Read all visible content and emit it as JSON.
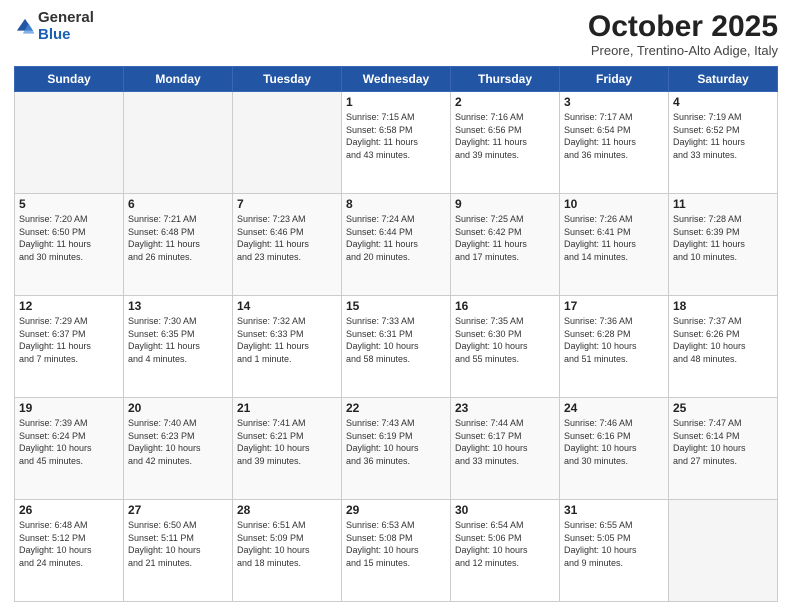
{
  "header": {
    "logo_general": "General",
    "logo_blue": "Blue",
    "month_title": "October 2025",
    "subtitle": "Preore, Trentino-Alto Adige, Italy"
  },
  "weekdays": [
    "Sunday",
    "Monday",
    "Tuesday",
    "Wednesday",
    "Thursday",
    "Friday",
    "Saturday"
  ],
  "weeks": [
    [
      {
        "day": "",
        "info": ""
      },
      {
        "day": "",
        "info": ""
      },
      {
        "day": "",
        "info": ""
      },
      {
        "day": "1",
        "info": "Sunrise: 7:15 AM\nSunset: 6:58 PM\nDaylight: 11 hours\nand 43 minutes."
      },
      {
        "day": "2",
        "info": "Sunrise: 7:16 AM\nSunset: 6:56 PM\nDaylight: 11 hours\nand 39 minutes."
      },
      {
        "day": "3",
        "info": "Sunrise: 7:17 AM\nSunset: 6:54 PM\nDaylight: 11 hours\nand 36 minutes."
      },
      {
        "day": "4",
        "info": "Sunrise: 7:19 AM\nSunset: 6:52 PM\nDaylight: 11 hours\nand 33 minutes."
      }
    ],
    [
      {
        "day": "5",
        "info": "Sunrise: 7:20 AM\nSunset: 6:50 PM\nDaylight: 11 hours\nand 30 minutes."
      },
      {
        "day": "6",
        "info": "Sunrise: 7:21 AM\nSunset: 6:48 PM\nDaylight: 11 hours\nand 26 minutes."
      },
      {
        "day": "7",
        "info": "Sunrise: 7:23 AM\nSunset: 6:46 PM\nDaylight: 11 hours\nand 23 minutes."
      },
      {
        "day": "8",
        "info": "Sunrise: 7:24 AM\nSunset: 6:44 PM\nDaylight: 11 hours\nand 20 minutes."
      },
      {
        "day": "9",
        "info": "Sunrise: 7:25 AM\nSunset: 6:42 PM\nDaylight: 11 hours\nand 17 minutes."
      },
      {
        "day": "10",
        "info": "Sunrise: 7:26 AM\nSunset: 6:41 PM\nDaylight: 11 hours\nand 14 minutes."
      },
      {
        "day": "11",
        "info": "Sunrise: 7:28 AM\nSunset: 6:39 PM\nDaylight: 11 hours\nand 10 minutes."
      }
    ],
    [
      {
        "day": "12",
        "info": "Sunrise: 7:29 AM\nSunset: 6:37 PM\nDaylight: 11 hours\nand 7 minutes."
      },
      {
        "day": "13",
        "info": "Sunrise: 7:30 AM\nSunset: 6:35 PM\nDaylight: 11 hours\nand 4 minutes."
      },
      {
        "day": "14",
        "info": "Sunrise: 7:32 AM\nSunset: 6:33 PM\nDaylight: 11 hours\nand 1 minute."
      },
      {
        "day": "15",
        "info": "Sunrise: 7:33 AM\nSunset: 6:31 PM\nDaylight: 10 hours\nand 58 minutes."
      },
      {
        "day": "16",
        "info": "Sunrise: 7:35 AM\nSunset: 6:30 PM\nDaylight: 10 hours\nand 55 minutes."
      },
      {
        "day": "17",
        "info": "Sunrise: 7:36 AM\nSunset: 6:28 PM\nDaylight: 10 hours\nand 51 minutes."
      },
      {
        "day": "18",
        "info": "Sunrise: 7:37 AM\nSunset: 6:26 PM\nDaylight: 10 hours\nand 48 minutes."
      }
    ],
    [
      {
        "day": "19",
        "info": "Sunrise: 7:39 AM\nSunset: 6:24 PM\nDaylight: 10 hours\nand 45 minutes."
      },
      {
        "day": "20",
        "info": "Sunrise: 7:40 AM\nSunset: 6:23 PM\nDaylight: 10 hours\nand 42 minutes."
      },
      {
        "day": "21",
        "info": "Sunrise: 7:41 AM\nSunset: 6:21 PM\nDaylight: 10 hours\nand 39 minutes."
      },
      {
        "day": "22",
        "info": "Sunrise: 7:43 AM\nSunset: 6:19 PM\nDaylight: 10 hours\nand 36 minutes."
      },
      {
        "day": "23",
        "info": "Sunrise: 7:44 AM\nSunset: 6:17 PM\nDaylight: 10 hours\nand 33 minutes."
      },
      {
        "day": "24",
        "info": "Sunrise: 7:46 AM\nSunset: 6:16 PM\nDaylight: 10 hours\nand 30 minutes."
      },
      {
        "day": "25",
        "info": "Sunrise: 7:47 AM\nSunset: 6:14 PM\nDaylight: 10 hours\nand 27 minutes."
      }
    ],
    [
      {
        "day": "26",
        "info": "Sunrise: 6:48 AM\nSunset: 5:12 PM\nDaylight: 10 hours\nand 24 minutes."
      },
      {
        "day": "27",
        "info": "Sunrise: 6:50 AM\nSunset: 5:11 PM\nDaylight: 10 hours\nand 21 minutes."
      },
      {
        "day": "28",
        "info": "Sunrise: 6:51 AM\nSunset: 5:09 PM\nDaylight: 10 hours\nand 18 minutes."
      },
      {
        "day": "29",
        "info": "Sunrise: 6:53 AM\nSunset: 5:08 PM\nDaylight: 10 hours\nand 15 minutes."
      },
      {
        "day": "30",
        "info": "Sunrise: 6:54 AM\nSunset: 5:06 PM\nDaylight: 10 hours\nand 12 minutes."
      },
      {
        "day": "31",
        "info": "Sunrise: 6:55 AM\nSunset: 5:05 PM\nDaylight: 10 hours\nand 9 minutes."
      },
      {
        "day": "",
        "info": ""
      }
    ]
  ]
}
